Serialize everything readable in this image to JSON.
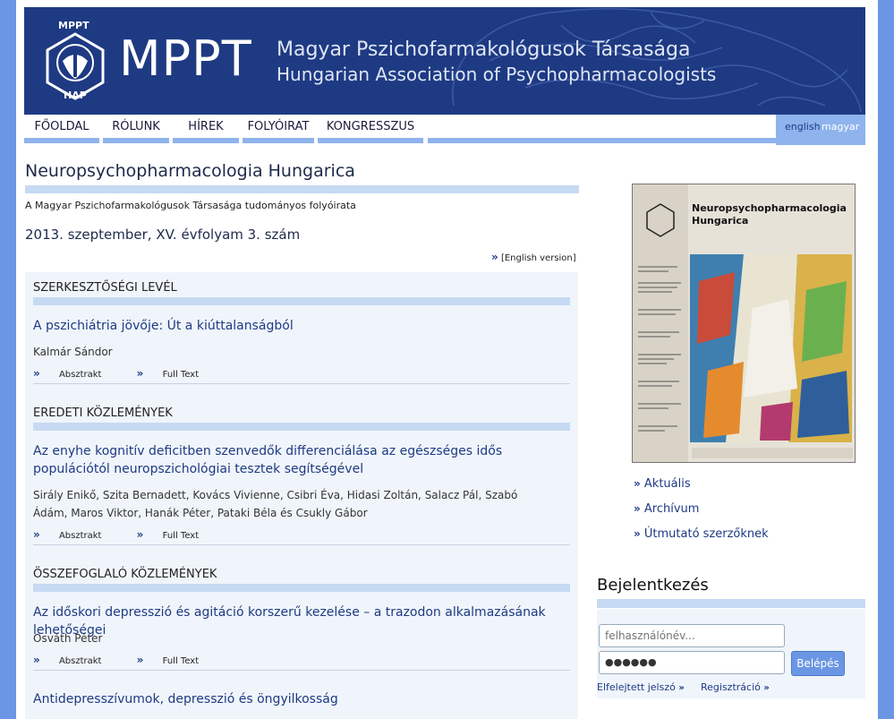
{
  "header": {
    "logo_abbr": "MPPT",
    "logo_top": "MPPT",
    "logo_bottom": "HAP",
    "title_hu": "Magyar Pszichofarmakológusok Társasága",
    "title_en": "Hungarian Association of Psychopharmacologists"
  },
  "nav": {
    "items": [
      "FŐOLDAL",
      "RÓLUNK",
      "HÍREK",
      "FOLYÓIRAT",
      "KONGRESSZUS"
    ],
    "lang_en": "english",
    "lang_hu": "magyar"
  },
  "main": {
    "title": "Neuropsychopharmacologia Hungarica",
    "subtitle": "A Magyar Pszichofarmakológusok Társasága tudományos folyóirata",
    "issue": "2013. szeptember, XV. évfolyam 3. szám",
    "english_version": "[English version]",
    "sections": [
      {
        "title": "SZERKESZTŐSÉGI LEVÉL",
        "article": "A pszichiátria jövője: Út a kiúttalanságból",
        "authors": "Kalmár Sándor"
      },
      {
        "title": "EREDETI KÖZLEMÉNYEK",
        "article": "Az enyhe kognitív deficitben szenvedők differenciálása az egészséges idős populációtól neuropszichológiai tesztek segítségével",
        "authors": "Sirály Enikő, Szita Bernadett, Kovács Vivienne, Csibri Éva, Hidasi Zoltán, Salacz Pál, Szabó Ádám, Maros Viktor, Hanák Péter, Pataki Béla és Csukly Gábor"
      },
      {
        "title": "ÖSSZEFOGLALÓ KÖZLEMÉNYEK",
        "article": "Az időskori depresszió és agitáció korszerű kezelése – a trazodon alkalmazásának lehetőségei",
        "authors": "Osváth Péter"
      }
    ],
    "last_article": "Antidepresszívumok, depresszió és öngyilkosság",
    "abstract_label": "Absztrakt",
    "fulltext_label": "Full Text"
  },
  "sidebar": {
    "cover_title": "Neuropsychopharmacologia Hungarica",
    "links": [
      "Aktuális",
      "Archívum",
      "Útmutató szerzőknek"
    ],
    "login_title": "Bejelentkezés",
    "username_placeholder": "felhasználónév...",
    "password_value": "●●●●●●",
    "login_button": "Belépés",
    "forgot": "Elfelejtett jelszó",
    "register": "Regisztráció"
  }
}
